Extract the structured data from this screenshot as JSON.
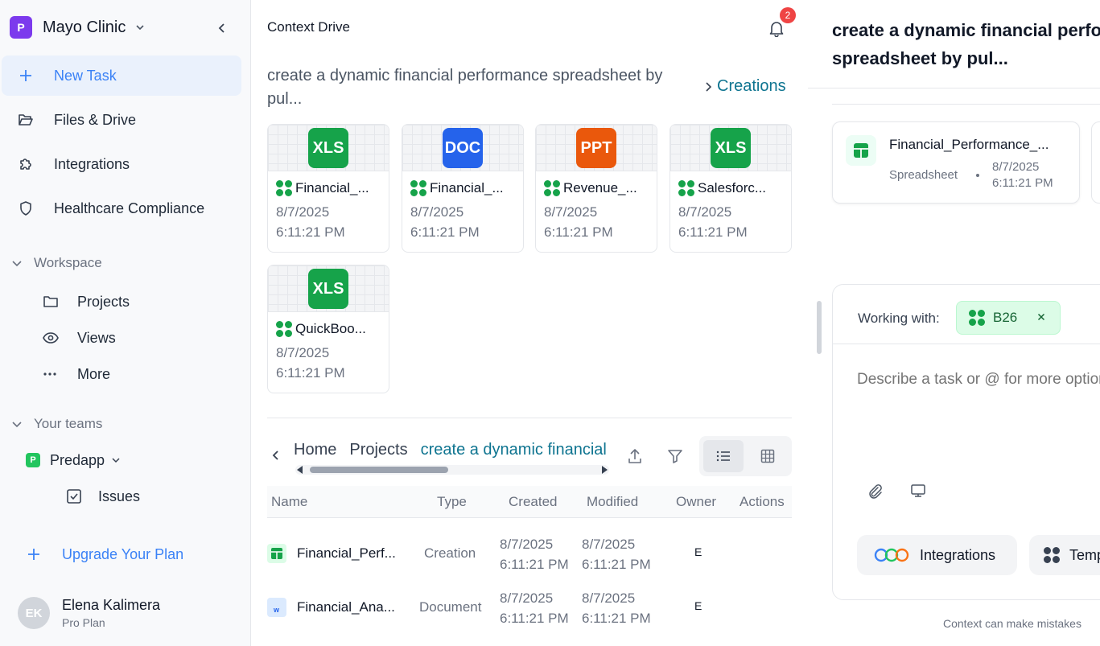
{
  "sidebar": {
    "org_initial": "P",
    "org_name": "Mayo Clinic",
    "nav": [
      {
        "label": "New Task",
        "icon": "plus-icon"
      },
      {
        "label": "Files & Drive",
        "icon": "folder-open-icon"
      },
      {
        "label": "Integrations",
        "icon": "puzzle-icon"
      },
      {
        "label": "Healthcare Compliance",
        "icon": "shield-icon"
      }
    ],
    "workspace": {
      "label": "Workspace",
      "items": [
        {
          "label": "Projects",
          "icon": "folder-icon"
        },
        {
          "label": "Views",
          "icon": "eye-icon"
        },
        {
          "label": "More",
          "icon": "more-dots-icon"
        }
      ]
    },
    "teams": {
      "label": "Your teams",
      "team_initial": "P",
      "team_name": "Predapp",
      "sub_items": [
        {
          "label": "Issues",
          "icon": "checkbox-icon"
        }
      ]
    },
    "upgrade_label": "Upgrade Your Plan",
    "user": {
      "initials": "EK",
      "name": "Elena Kalimera",
      "plan": "Pro Plan"
    }
  },
  "drive": {
    "title": "Context Drive",
    "notification_count": "2",
    "task_heading": "create a dynamic financial performance spreadsheet by pul...",
    "creations_label": "Creations",
    "files": [
      {
        "type": "XLS",
        "color": "#16a34a",
        "name": "Financial_...",
        "date": "8/7/2025",
        "time": "6:11:21 PM"
      },
      {
        "type": "DOC",
        "color": "#2563eb",
        "name": "Financial_...",
        "date": "8/7/2025",
        "time": "6:11:21 PM"
      },
      {
        "type": "PPT",
        "color": "#ea580c",
        "name": "Revenue_...",
        "date": "8/7/2025",
        "time": "6:11:21 PM"
      },
      {
        "type": "XLS",
        "color": "#16a34a",
        "name": "Salesforc...",
        "date": "8/7/2025",
        "time": "6:11:21 PM"
      },
      {
        "type": "XLS",
        "color": "#16a34a",
        "name": "QuickBoo...",
        "date": "8/7/2025",
        "time": "6:11:21 PM"
      }
    ],
    "breadcrumbs": [
      "Home",
      "Projects",
      "create a dynamic financial performance spreadsheet by pul..."
    ],
    "table": {
      "headers": [
        "Name",
        "Type",
        "Created",
        "Modified",
        "Owner",
        "Actions"
      ],
      "rows": [
        {
          "icon": "spreadsheet-icon",
          "name": "Financial_Perf...",
          "type": "Creation",
          "created_date": "8/7/2025",
          "created_time": "6:11:21 PM",
          "modified_date": "8/7/2025",
          "modified_time": "6:11:21 PM",
          "owner": "E"
        },
        {
          "icon": "document-icon",
          "name": "Financial_Ana...",
          "type": "Document",
          "created_date": "8/7/2025",
          "created_time": "6:11:21 PM",
          "modified_date": "8/7/2025",
          "modified_time": "6:11:21 PM",
          "owner": "E"
        }
      ]
    }
  },
  "task_panel": {
    "title_line1": "create a dynamic financial performance",
    "title_line2": "spreadsheet by pul...",
    "artifact": {
      "name": "Financial_Performance_...",
      "type": "Spreadsheet",
      "date": "8/7/2025",
      "time": "6:11:21 PM"
    },
    "working_with_label": "Working with:",
    "chip_label": "B26",
    "input_placeholder": "Describe a task or @ for more options",
    "integrations_label": "Integrations",
    "templates_label": "Templates",
    "disclaimer": "Context can make mistakes"
  },
  "colors": {
    "accent": "#3b82f6",
    "brand": "#7c3aed",
    "link": "#0e7490",
    "success": "#16a34a",
    "badge": "#ef4444"
  }
}
